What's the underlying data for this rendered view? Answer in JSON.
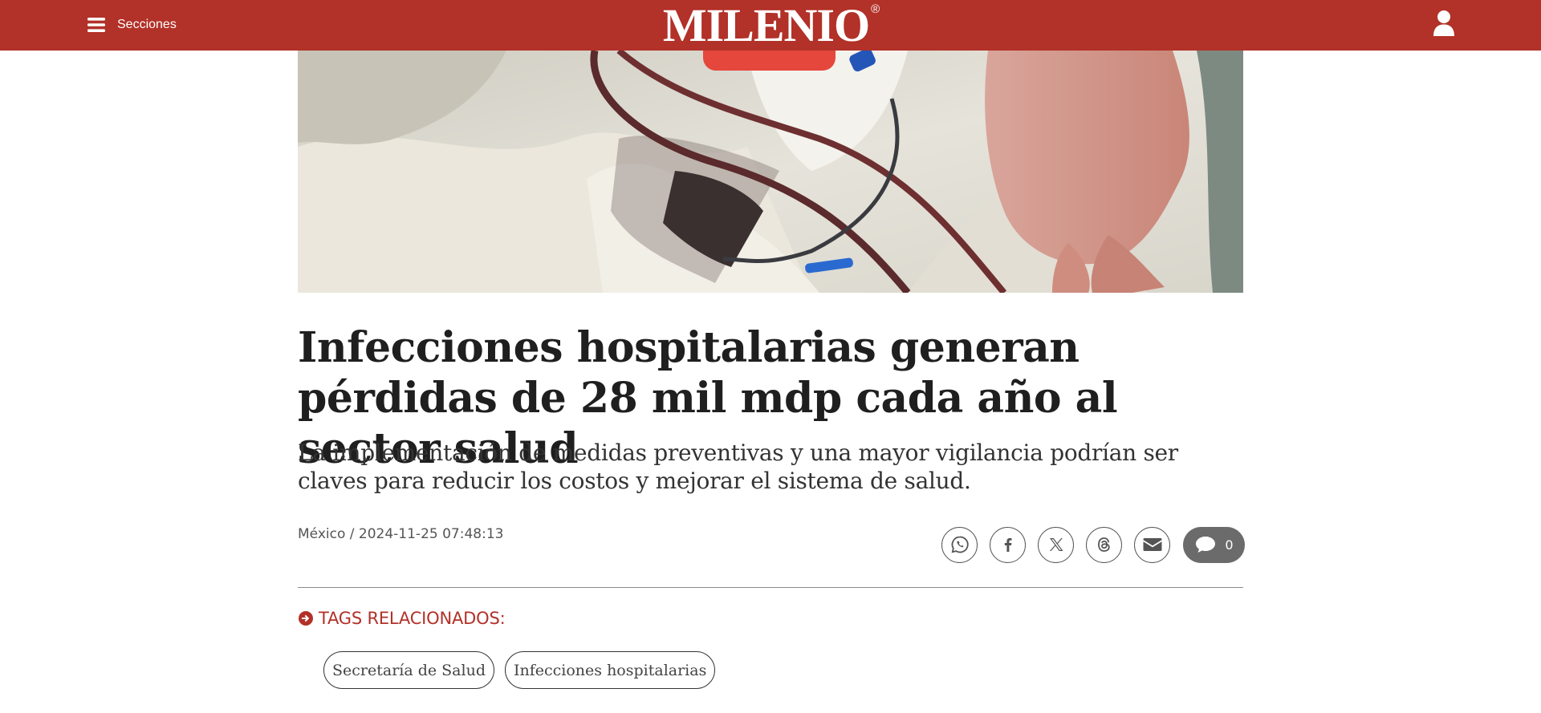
{
  "header": {
    "menu_label": "Secciones",
    "logo_text": "MILENIO",
    "logo_mark": "®",
    "background_color": "#b23128",
    "icons": {
      "menu": "hamburger-icon",
      "user": "user-icon"
    }
  },
  "hero": {
    "image_description_icon": "hospital-photo"
  },
  "article": {
    "headline": "Infecciones hospitalarias generan pérdidas de 28 mil mdp cada año al sector salud",
    "subheadline": "La implementación de medidas preventivas y una mayor vigilancia podrían ser claves para reducir los costos y mejorar el sistema de salud.",
    "location": "México",
    "separator": " / ",
    "timestamp": "2024-11-25 07:48:13"
  },
  "share": {
    "icons": [
      "whatsapp-icon",
      "facebook-icon",
      "x-icon",
      "threads-icon",
      "email-icon",
      "comment-icon"
    ],
    "comments_count": "0"
  },
  "tags": {
    "title": "TAGS RELACIONADOS:",
    "title_icon": "arrow-circle-right-icon",
    "accent_color": "#b23128",
    "items": [
      "Secretaría de Salud",
      "Infecciones hospitalarias"
    ]
  }
}
